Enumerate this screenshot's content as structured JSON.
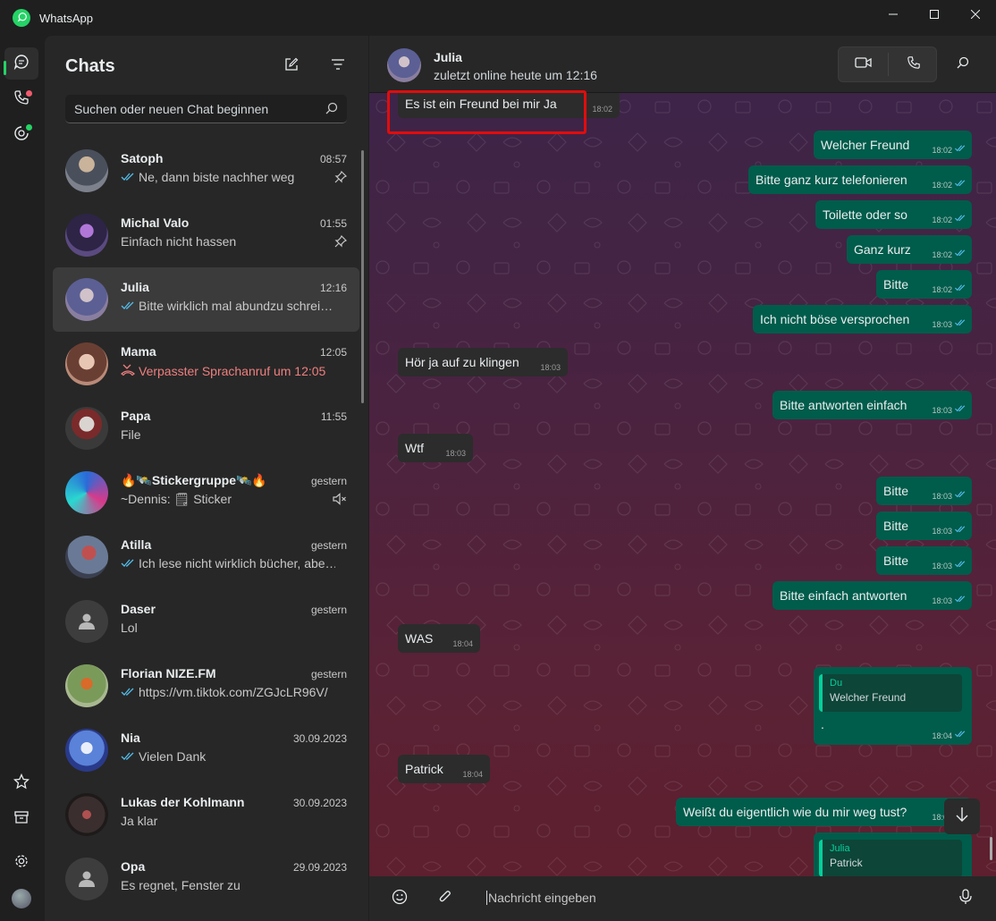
{
  "app": {
    "title": "WhatsApp"
  },
  "window_controls": [
    "minimize",
    "maximize",
    "close"
  ],
  "rail": {
    "items": [
      {
        "name": "chats-icon",
        "active": true
      },
      {
        "name": "calls-icon",
        "badge_color": "#f15c6d"
      },
      {
        "name": "status-icon",
        "badge_color": "#25d366"
      }
    ],
    "bottom": [
      {
        "name": "starred-icon"
      },
      {
        "name": "archive-icon"
      },
      {
        "name": "settings-icon"
      },
      {
        "name": "profile-avatar"
      }
    ]
  },
  "chat_list": {
    "title": "Chats",
    "search_placeholder": "Suchen oder neuen Chat beginnen",
    "chats": [
      {
        "name": "Satoph",
        "time": "08:57",
        "preview": "Ne, dann biste nachher weg",
        "ticks": true,
        "pinned": true,
        "avatar_color": "#6b6f7a"
      },
      {
        "name": "Michal Valo",
        "time": "01:55",
        "preview": "Einfach nicht hassen",
        "ticks": false,
        "pinned": true,
        "avatar_color": "#4b3a6e"
      },
      {
        "name": "Julia",
        "time": "12:16",
        "preview": "Bitte wirklich mal abundzu schrei…",
        "ticks": true,
        "selected": true,
        "avatar_color": "#5a5f8a"
      },
      {
        "name": "Mama",
        "time": "12:05",
        "preview": "Verpasster Sprachanruf um 12:05",
        "missed_call": true,
        "avatar_color": "#9a6a5a"
      },
      {
        "name": "Papa",
        "time": "11:55",
        "preview": "File",
        "avatar_color": "#5c4a4a"
      },
      {
        "name": "🔥🛰️Stickergruppe🛰️🔥",
        "time": "gestern",
        "preview": "~Dennis: 🗒 Sticker",
        "muted": true,
        "avatar_color": "#3a6ea8"
      },
      {
        "name": "Atilla",
        "time": "gestern",
        "preview": "Ich lese nicht wirklich bücher, abe…",
        "ticks": true,
        "avatar_color": "#7a4a4a"
      },
      {
        "name": "Daser",
        "time": "gestern",
        "preview": "Lol",
        "default_avatar": true
      },
      {
        "name": "Florian NIZE.FM",
        "time": "gestern",
        "preview": "https://vm.tiktok.com/ZGJcLR96V/",
        "ticks": true,
        "avatar_color": "#6a7a4a"
      },
      {
        "name": "Nia",
        "time": "30.09.2023",
        "preview": "Vielen Dank",
        "ticks": true,
        "avatar_color": "#3a5aa8"
      },
      {
        "name": "Lukas der Kohlmann",
        "time": "30.09.2023",
        "preview": "Ja klar",
        "avatar_color": "#3a3030"
      },
      {
        "name": "Opa",
        "time": "29.09.2023",
        "preview": "Es regnet, Fenster zu",
        "default_avatar": true
      }
    ]
  },
  "conversation": {
    "contact_name": "Julia",
    "status": "zuletzt online heute um 12:16",
    "messages": [
      {
        "dir": "in",
        "text": "Es ist ein Freund bei mir Ja",
        "time": "18:02"
      },
      {
        "dir": "out",
        "text": "Welcher Freund",
        "time": "18:02"
      },
      {
        "dir": "out",
        "text": "Bitte ganz kurz telefonieren",
        "time": "18:02"
      },
      {
        "dir": "out",
        "text": "Toilette oder so",
        "time": "18:02"
      },
      {
        "dir": "out",
        "text": "Ganz kurz",
        "time": "18:02"
      },
      {
        "dir": "out",
        "text": "Bitte",
        "time": "18:02"
      },
      {
        "dir": "out",
        "text": "Ich nicht böse versprochen",
        "time": "18:03"
      },
      {
        "dir": "in",
        "text": "Hör ja auf zu klingen",
        "time": "18:03"
      },
      {
        "dir": "out",
        "text": "Bitte antworten einfach",
        "time": "18:03"
      },
      {
        "dir": "in",
        "text": "Wtf",
        "time": "18:03"
      },
      {
        "dir": "out",
        "text": "Bitte",
        "time": "18:03"
      },
      {
        "dir": "out",
        "text": "Bitte",
        "time": "18:03"
      },
      {
        "dir": "out",
        "text": "Bitte",
        "time": "18:03"
      },
      {
        "dir": "out",
        "text": "Bitte einfach antworten",
        "time": "18:03"
      },
      {
        "dir": "in",
        "text": "WAS",
        "time": "18:04"
      },
      {
        "dir": "out",
        "text": ".",
        "time": "18:04",
        "quote_author": "Du",
        "quote_text": "Welcher Freund"
      },
      {
        "dir": "in",
        "text": "Patrick",
        "time": "18:04"
      },
      {
        "dir": "out",
        "text": "Weißt du eigentlich wie du mir weg tust?",
        "time": "18:04"
      },
      {
        "dir": "out",
        "text": "",
        "time": "",
        "quote_author": "Julia",
        "quote_text": "Patrick"
      }
    ]
  },
  "composer": {
    "placeholder": "Nachricht eingeben"
  },
  "colors": {
    "accent": "#25d366",
    "outgoing_bubble": "#005c4b",
    "incoming_bubble": "#2c2c2c",
    "read_ticks": "#53bdeb",
    "highlight_box": "#e20c0c"
  }
}
